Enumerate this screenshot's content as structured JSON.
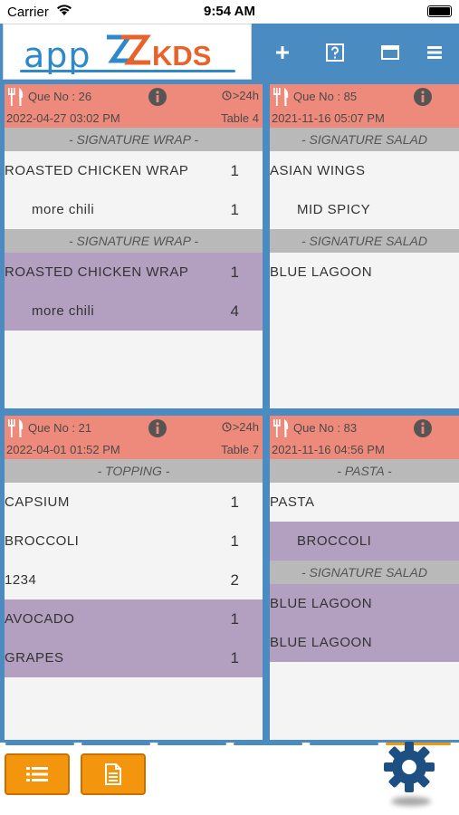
{
  "status": {
    "carrier": "Carrier",
    "time": "9:54 AM"
  },
  "header": {
    "logo_app": "app",
    "logo_kds": "KDS",
    "buttons": [
      "add-icon",
      "help-icon",
      "window-icon",
      "menu-icon"
    ]
  },
  "colors": {
    "header": "#4a8bc2",
    "card_head": "#ee8a7b",
    "section": "#b9b9b9",
    "highlight": "#b3a0c0",
    "orange": "#f4950e",
    "gear": "#1d4f82"
  },
  "orders": [
    {
      "que": "Que No : 26",
      "elapsed": ">24h",
      "datetime": "2022-04-27 03:02 PM",
      "table": "Table 4",
      "sections": [
        {
          "title": "- SIGNATURE WRAP -",
          "items": [
            {
              "name": "ROASTED CHICKEN WRAP",
              "qty": "1",
              "highlight": false,
              "modifier": false
            },
            {
              "name": "more chili",
              "qty": "1",
              "highlight": false,
              "modifier": true
            }
          ]
        },
        {
          "title": "- SIGNATURE WRAP -",
          "items": [
            {
              "name": "ROASTED CHICKEN WRAP",
              "qty": "1",
              "highlight": true,
              "modifier": false
            },
            {
              "name": "more chili",
              "qty": "4",
              "highlight": true,
              "modifier": true
            }
          ]
        }
      ]
    },
    {
      "que": "Que No : 85",
      "elapsed": "",
      "datetime": "2021-11-16 05:07 PM",
      "table": "",
      "sections": [
        {
          "title": "- SIGNATURE SALAD",
          "items": [
            {
              "name": "ASIAN WINGS",
              "qty": "",
              "highlight": false,
              "modifier": false
            },
            {
              "name": "MID SPICY",
              "qty": "",
              "highlight": false,
              "modifier": true
            }
          ]
        },
        {
          "title": "- SIGNATURE SALAD",
          "items": [
            {
              "name": "BLUE LAGOON",
              "qty": "",
              "highlight": false,
              "modifier": false
            }
          ]
        }
      ]
    },
    {
      "que": "Que No : 21",
      "elapsed": ">24h",
      "datetime": "2022-04-01 01:52 PM",
      "table": "Table 7",
      "sections": [
        {
          "title": "- TOPPING -",
          "items": [
            {
              "name": "CAPSIUM",
              "qty": "1",
              "highlight": false,
              "modifier": false
            },
            {
              "name": "BROCCOLI",
              "qty": "1",
              "highlight": false,
              "modifier": false
            },
            {
              "name": "1234",
              "qty": "2",
              "highlight": false,
              "modifier": false
            },
            {
              "name": "AVOCADO",
              "qty": "1",
              "highlight": true,
              "modifier": false
            },
            {
              "name": "GRAPES",
              "qty": "1",
              "highlight": true,
              "modifier": false
            }
          ]
        }
      ]
    },
    {
      "que": "Que No : 83",
      "elapsed": "",
      "datetime": "2021-11-16 04:56 PM",
      "table": "",
      "sections": [
        {
          "title": "- PASTA -",
          "items": [
            {
              "name": "PASTA",
              "qty": "",
              "highlight": false,
              "modifier": false
            },
            {
              "name": "BROCCOLI",
              "qty": "",
              "highlight": true,
              "modifier": true
            }
          ]
        },
        {
          "title": "- SIGNATURE SALAD",
          "items": [
            {
              "name": "BLUE LAGOON",
              "qty": "",
              "highlight": true,
              "modifier": false
            },
            {
              "name": "BLUE LAGOON",
              "qty": "",
              "highlight": true,
              "modifier": false
            }
          ]
        }
      ]
    }
  ],
  "bottom": {
    "buttons": [
      "list-icon",
      "document-icon"
    ],
    "settings": "gear-icon"
  }
}
